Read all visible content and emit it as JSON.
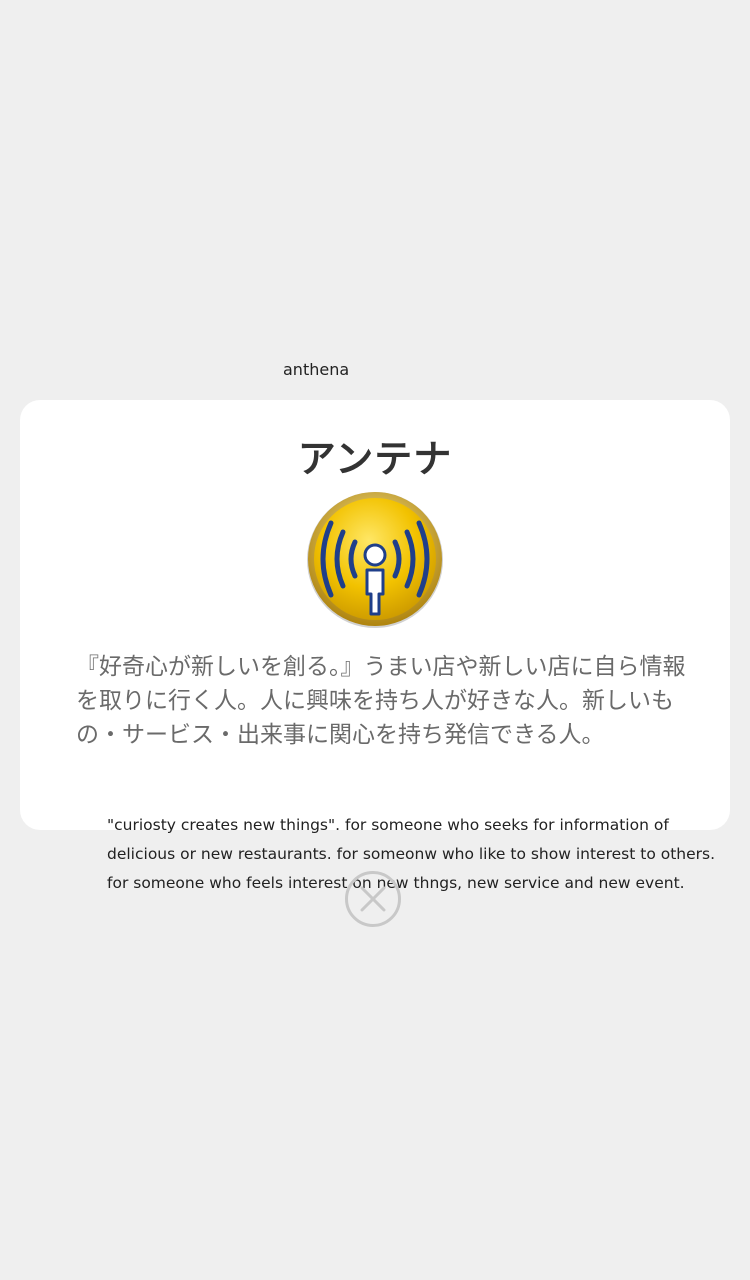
{
  "header": {
    "app_label": "anthena"
  },
  "card": {
    "title": "アンテナ",
    "icon": "antenna-broadcast-person-icon",
    "description_jp": "『好奇心が新しいを創る。』うまい店や新しい店に自ら情報を取りに行く人。人に興味を持ち人が好きな人。新しいもの・サービス・出来事に関心を持ち発信できる人。",
    "description_en": "\"curiosty creates new things\". for someone who seeks  for information of delicious or new restaurants. for someonw who like to show interest to others. for someone who feels interest on new thngs, new service and new event."
  },
  "close": {
    "icon": "close-icon"
  },
  "colors": {
    "background": "#efefef",
    "card": "#ffffff",
    "logo_gold": "#f2c200",
    "logo_blue": "#1f3f8a",
    "close_ring": "#c8c8c8"
  }
}
